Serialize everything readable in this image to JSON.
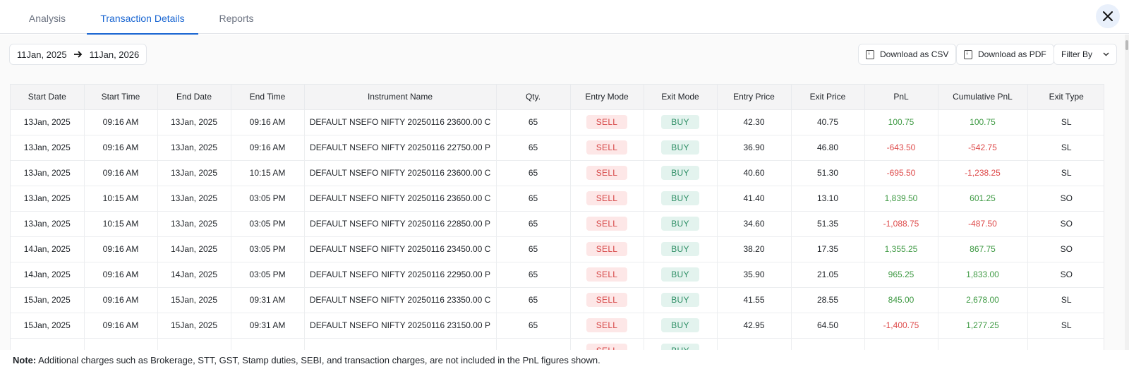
{
  "tabs": [
    {
      "label": "Analysis"
    },
    {
      "label": "Transaction Details"
    },
    {
      "label": "Reports"
    }
  ],
  "date_range": {
    "start": "11Jan, 2025",
    "end": "11Jan, 2026"
  },
  "actions": {
    "download_csv": "Download as CSV",
    "download_pdf": "Download as PDF",
    "filter_by": "Filter By"
  },
  "table": {
    "columns": [
      "Start Date",
      "Start Time",
      "End Date",
      "End Time",
      "Instrument Name",
      "Qty.",
      "Entry Mode",
      "Exit Mode",
      "Entry Price",
      "Exit Price",
      "PnL",
      "Cumulative PnL",
      "Exit Type"
    ],
    "rows": [
      [
        "13Jan, 2025",
        "09:16 AM",
        "13Jan, 2025",
        "09:16 AM",
        "DEFAULT NSEFO NIFTY 20250116 23600.00 C",
        "65",
        "SELL",
        "BUY",
        "42.30",
        "40.75",
        "100.75",
        "100.75",
        "SL"
      ],
      [
        "13Jan, 2025",
        "09:16 AM",
        "13Jan, 2025",
        "09:16 AM",
        "DEFAULT NSEFO NIFTY 20250116 22750.00 P",
        "65",
        "SELL",
        "BUY",
        "36.90",
        "46.80",
        "-643.50",
        "-542.75",
        "SL"
      ],
      [
        "13Jan, 2025",
        "09:16 AM",
        "13Jan, 2025",
        "10:15 AM",
        "DEFAULT NSEFO NIFTY 20250116 23600.00 C",
        "65",
        "SELL",
        "BUY",
        "40.60",
        "51.30",
        "-695.50",
        "-1,238.25",
        "SL"
      ],
      [
        "13Jan, 2025",
        "10:15 AM",
        "13Jan, 2025",
        "03:05 PM",
        "DEFAULT NSEFO NIFTY 20250116 23650.00 C",
        "65",
        "SELL",
        "BUY",
        "41.40",
        "13.10",
        "1,839.50",
        "601.25",
        "SO"
      ],
      [
        "13Jan, 2025",
        "10:15 AM",
        "13Jan, 2025",
        "03:05 PM",
        "DEFAULT NSEFO NIFTY 20250116 22850.00 P",
        "65",
        "SELL",
        "BUY",
        "34.60",
        "51.35",
        "-1,088.75",
        "-487.50",
        "SO"
      ],
      [
        "14Jan, 2025",
        "09:16 AM",
        "14Jan, 2025",
        "03:05 PM",
        "DEFAULT NSEFO NIFTY 20250116 23450.00 C",
        "65",
        "SELL",
        "BUY",
        "38.20",
        "17.35",
        "1,355.25",
        "867.75",
        "SO"
      ],
      [
        "14Jan, 2025",
        "09:16 AM",
        "14Jan, 2025",
        "03:05 PM",
        "DEFAULT NSEFO NIFTY 20250116 22950.00 P",
        "65",
        "SELL",
        "BUY",
        "35.90",
        "21.05",
        "965.25",
        "1,833.00",
        "SO"
      ],
      [
        "15Jan, 2025",
        "09:16 AM",
        "15Jan, 2025",
        "09:31 AM",
        "DEFAULT NSEFO NIFTY 20250116 23350.00 C",
        "65",
        "SELL",
        "BUY",
        "41.55",
        "28.55",
        "845.00",
        "2,678.00",
        "SL"
      ],
      [
        "15Jan, 2025",
        "09:16 AM",
        "15Jan, 2025",
        "09:31 AM",
        "DEFAULT NSEFO NIFTY 20250116 23150.00 P",
        "65",
        "SELL",
        "BUY",
        "42.95",
        "64.50",
        "-1,400.75",
        "1,277.25",
        "SL"
      ],
      [
        "",
        "",
        "",
        "",
        "",
        "",
        "SELL",
        "BUY",
        "",
        "",
        "",
        "",
        ""
      ]
    ]
  },
  "note": {
    "label": "Note:",
    "text": "Additional charges such as Brokerage, STT, GST, Stamp duties, SEBI, and transaction charges, are not included in the PnL figures shown."
  },
  "colors": {
    "accent": "#1a66d2",
    "positive": "#3f9a44",
    "negative": "#de4b4b"
  }
}
